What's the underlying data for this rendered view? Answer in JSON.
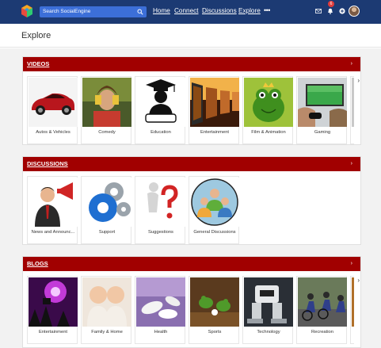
{
  "header": {
    "search_placeholder": "Search SocialEngine",
    "nav": [
      "Home",
      "Connect",
      "Discussions",
      "Explore"
    ],
    "more": "•••",
    "notification_count": "6"
  },
  "page": {
    "title": "Explore"
  },
  "sections": [
    {
      "title": "VIDEOS",
      "arrow": "›",
      "items": [
        "Autos & Vehicles",
        "Comedy",
        "Education",
        "Entertainment",
        "Film & Animation",
        "Gaming"
      ]
    },
    {
      "title": "DISCUSSIONS",
      "arrow": "›",
      "items": [
        "News and Announc...",
        "Support",
        "Suggestions",
        "General Discussions"
      ]
    },
    {
      "title": "BLOGS",
      "arrow": "›",
      "items": [
        "Entertainment",
        "Family & Home",
        "Health",
        "Sports",
        "Technology",
        "Recreation"
      ]
    }
  ],
  "icons": {
    "logo": "socialengine-cube-logo",
    "search": "search-icon",
    "mail": "mail-icon",
    "bell": "bell-icon",
    "plus": "plus-circle-icon",
    "next": "chevron-right-icon"
  }
}
